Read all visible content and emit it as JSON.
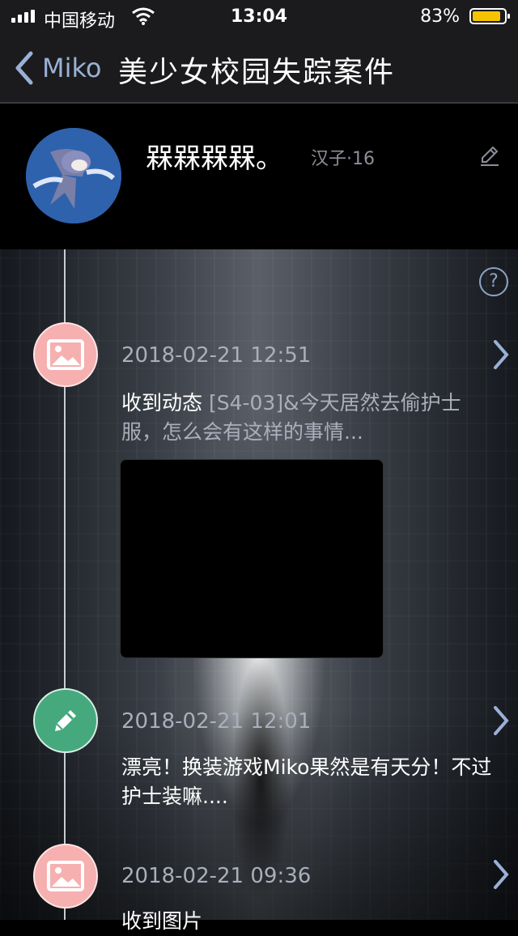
{
  "status": {
    "carrier": "中国移动",
    "time": "13:04",
    "battery": "83%",
    "battery_level": 0.83,
    "icons": [
      "signal-icon",
      "wifi-icon",
      "battery-icon"
    ]
  },
  "nav": {
    "back_label": "Miko",
    "title": "美少女校园失踪案件"
  },
  "profile": {
    "name": "槑槑槑槑。",
    "meta": "汉子·16"
  },
  "help": "?",
  "entries": [
    {
      "type": "image-icon",
      "date": "2018-02-21 12:51",
      "text": "收到动态",
      "text_gray": "[S4-03]&今天居然去偷护士服，怎么会有这样的事情..."
    },
    {
      "type": "pencil-icon",
      "date": "2018-02-21 12:01",
      "text": "漂亮！换装游戏Miko果然是有天分！不过护士装嘛...."
    },
    {
      "type": "image-icon",
      "date": "2018-02-21 09:36",
      "text": "收到图片"
    }
  ],
  "colors": {
    "pink": "#f6b0b0",
    "green": "#46a97e",
    "accent": "#9ab0d6"
  }
}
